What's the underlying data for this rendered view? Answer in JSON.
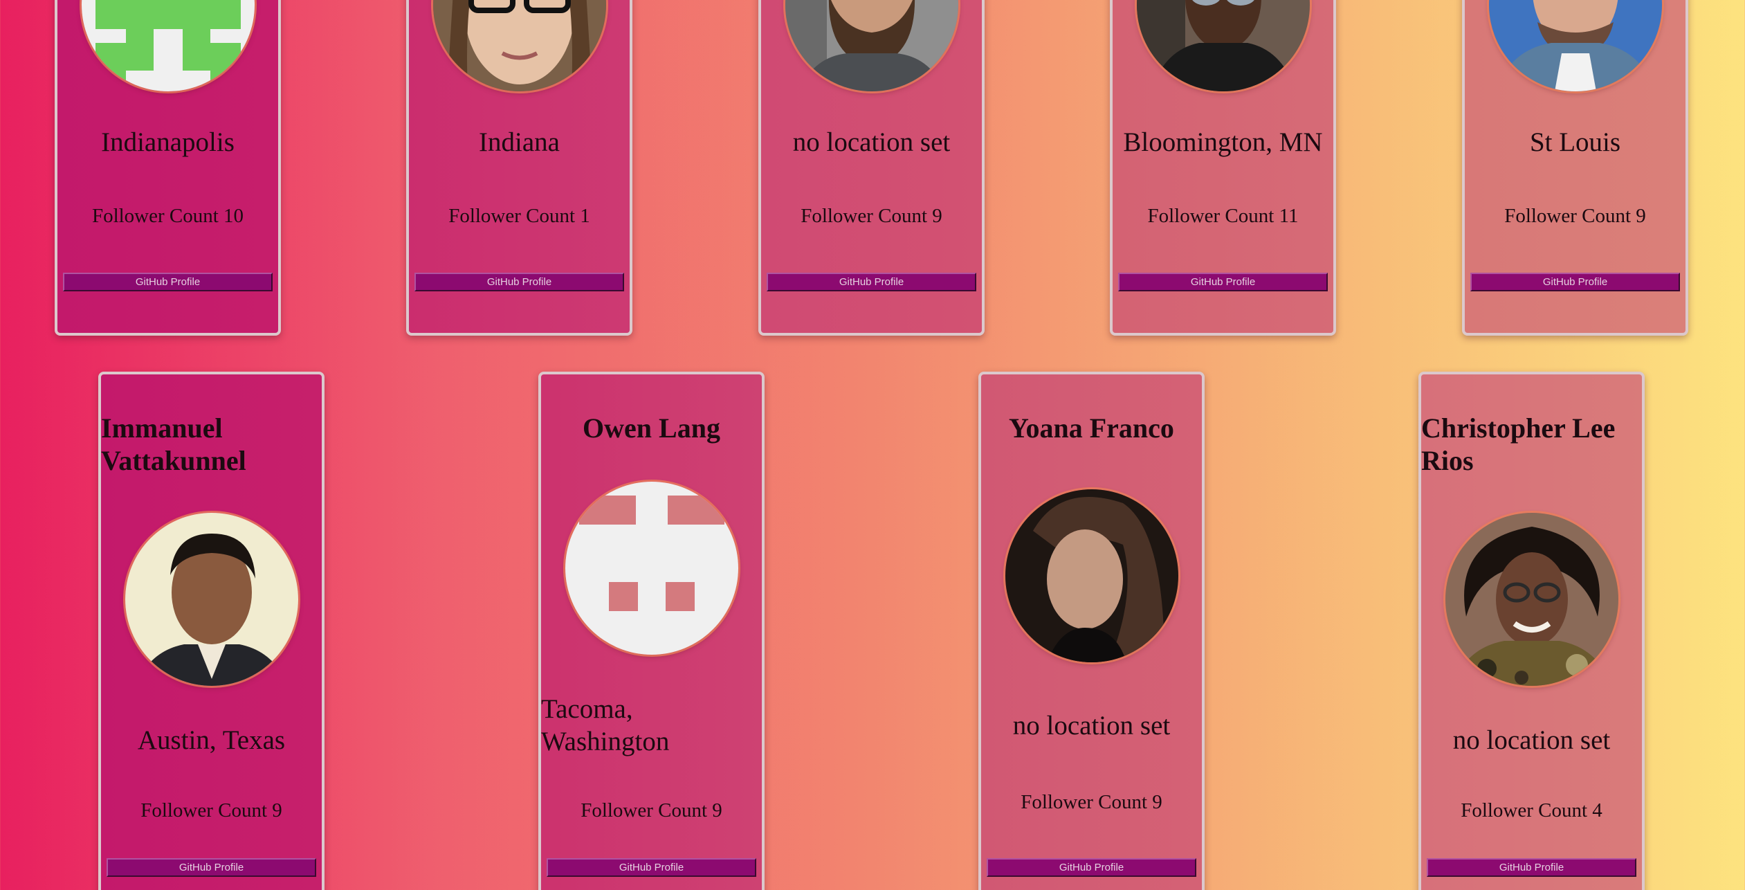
{
  "colors": {
    "button_bg": "#8c0a70",
    "button_text": "#e6d0e0",
    "card_border": "#dcc8cc"
  },
  "cards_row1": [
    {
      "location": "Indianapolis",
      "followers": "Follower Count 10",
      "button": "GitHub Profile",
      "avatar": "identicon-green"
    },
    {
      "location": "Indiana",
      "followers": "Follower Count 1",
      "button": "GitHub Profile",
      "avatar": "photo-woman-glasses"
    },
    {
      "location": "no location set",
      "followers": "Follower Count 9",
      "button": "GitHub Profile",
      "avatar": "photo-bearded-man"
    },
    {
      "location": "Bloomington, MN",
      "followers": "Follower Count 11",
      "button": "GitHub Profile",
      "avatar": "photo-man-sunglasses"
    },
    {
      "location": "St Louis",
      "followers": "Follower Count 9",
      "button": "GitHub Profile",
      "avatar": "photo-man-beanie"
    }
  ],
  "cards_row2": [
    {
      "name": "Immanuel Vattakunnel",
      "location": "Austin, Texas",
      "followers": "Follower Count 9",
      "button": "GitHub Profile",
      "avatar": "photo-man-suit"
    },
    {
      "name": "Owen Lang",
      "location": "Tacoma, Washington",
      "followers": "Follower Count 9",
      "button": "GitHub Profile",
      "avatar": "identicon-pink"
    },
    {
      "name": "Yoana Franco",
      "location": "no location set",
      "followers": "Follower Count 9",
      "button": "GitHub Profile",
      "avatar": "photo-woman-dark"
    },
    {
      "name": "Christopher Lee Rios",
      "location": "no location set",
      "followers": "Follower Count 4",
      "button": "GitHub Profile",
      "avatar": "photo-man-camo"
    }
  ]
}
